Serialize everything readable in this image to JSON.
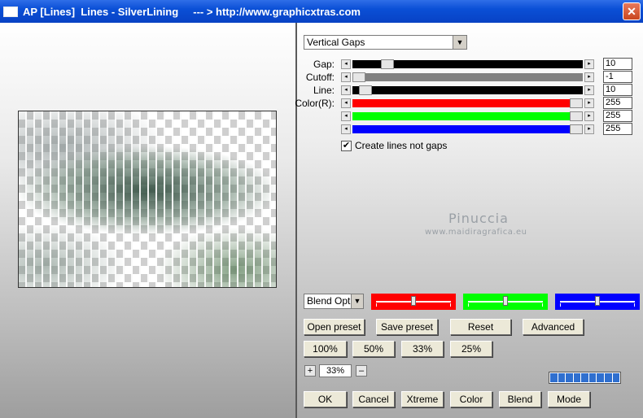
{
  "window": {
    "title": "AP [Lines]  Lines - SilverLining     --- > http://www.graphicxtras.com",
    "close_label": "✕"
  },
  "mode_select": {
    "value": "Vertical Gaps"
  },
  "sliders": [
    {
      "label": "Gap:",
      "value": "10",
      "level": 0.13,
      "track_color": "#000000"
    },
    {
      "label": "Cutoff:",
      "value": "-1",
      "level": 0.0,
      "track_color": "#808080"
    },
    {
      "label": "Line:",
      "value": "10",
      "level": 0.03,
      "track_color": "#000000"
    },
    {
      "label": "Color(R):",
      "value": "255",
      "level": 1.0,
      "track_color": "#ff0000"
    },
    {
      "label": "",
      "value": "255",
      "level": 1.0,
      "track_color": "#00ff00"
    },
    {
      "label": "",
      "value": "255",
      "level": 1.0,
      "track_color": "#0000ff"
    }
  ],
  "checkbox": {
    "label": "Create lines not gaps",
    "checked": true,
    "mark": "✔"
  },
  "watermark": {
    "line1": "Pinuccia",
    "line2": "www.maidiragrafica.eu"
  },
  "blend_select": {
    "value": "Blend Optio"
  },
  "blend_colors": [
    {
      "color": "#ff0000",
      "level": 0.5
    },
    {
      "color": "#00ff00",
      "level": 0.5
    },
    {
      "color": "#0000ff",
      "level": 0.5
    }
  ],
  "buttons_row1": [
    "Open preset",
    "Save preset",
    "Reset",
    "Advanced"
  ],
  "zoom_buttons": [
    "100%",
    "50%",
    "33%",
    "25%"
  ],
  "zoom": {
    "plus": "+",
    "value": "33%",
    "minus": "–"
  },
  "progress": {
    "segments": 9
  },
  "buttons_bottom": [
    "OK",
    "Cancel",
    "Xtreme",
    "Color",
    "Blend",
    "Mode"
  ]
}
